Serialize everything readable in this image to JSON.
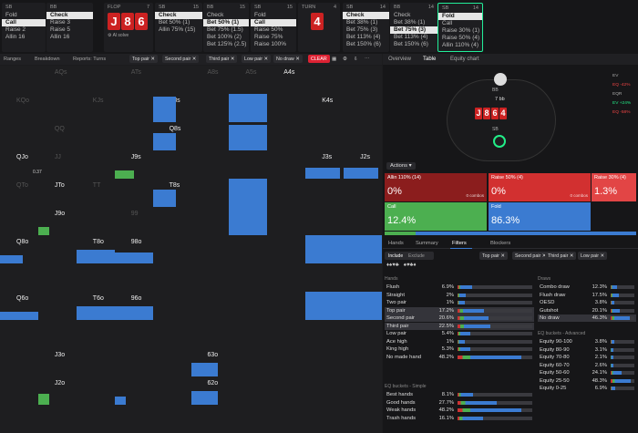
{
  "top_cols": [
    {
      "pos": "SB",
      "stack": "",
      "options": [
        {
          "l": "Fold",
          "v": "",
          "sel": false
        },
        {
          "l": "Call",
          "v": "",
          "sel": true
        },
        {
          "l": "Raise 2",
          "v": "",
          "sel": false
        },
        {
          "l": "Allin 16",
          "v": "",
          "sel": false
        }
      ]
    },
    {
      "pos": "BB",
      "stack": "",
      "options": [
        {
          "l": "Check",
          "v": "",
          "sel": true
        },
        {
          "l": "Raise 3",
          "v": "",
          "sel": false
        },
        {
          "l": "Raise 5",
          "v": "",
          "sel": false
        },
        {
          "l": "Allin 16",
          "v": "",
          "sel": false
        }
      ]
    },
    {
      "pos": "SB",
      "stack": "15",
      "options": [
        {
          "l": "Check",
          "v": "",
          "sel": true
        },
        {
          "l": "Bet 50%",
          "v": "(1)",
          "sel": false
        },
        {
          "l": "Allin 75%",
          "v": "(15)",
          "sel": false
        }
      ]
    },
    {
      "pos": "BB",
      "stack": "15",
      "options": [
        {
          "l": "Check",
          "v": "",
          "sel": false
        },
        {
          "l": "Bet 50%",
          "v": "(1)",
          "sel": true
        },
        {
          "l": "Bet 75%",
          "v": "(1.5)",
          "sel": false
        },
        {
          "l": "Bet 100%",
          "v": "(2)",
          "sel": false
        },
        {
          "l": "Bet 125%",
          "v": "(2.5)",
          "sel": false
        }
      ]
    },
    {
      "pos": "SB",
      "stack": "15",
      "options": [
        {
          "l": "Fold",
          "v": "",
          "sel": false
        },
        {
          "l": "Call",
          "v": "",
          "sel": true
        },
        {
          "l": "Raise 50%",
          "v": "",
          "sel": false
        },
        {
          "l": "Raise 75%",
          "v": "",
          "sel": false
        },
        {
          "l": "Raise 100%",
          "v": "",
          "sel": false
        }
      ]
    },
    {
      "pos": "SB",
      "stack": "14",
      "options": [
        {
          "l": "Check",
          "v": "",
          "sel": true
        },
        {
          "l": "Bet 38%",
          "v": "(1)",
          "sel": false
        },
        {
          "l": "Bet 75%",
          "v": "(3)",
          "sel": false
        },
        {
          "l": "Bet 113%",
          "v": "(4)",
          "sel": false
        },
        {
          "l": "Bet 150%",
          "v": "(6)",
          "sel": false
        }
      ]
    },
    {
      "pos": "BB",
      "stack": "14",
      "options": [
        {
          "l": "Check",
          "v": "",
          "sel": false
        },
        {
          "l": "Bet 38%",
          "v": "(1)",
          "sel": false
        },
        {
          "l": "Bet 75%",
          "v": "(3)",
          "sel": true
        },
        {
          "l": "Bet 113%",
          "v": "(4)",
          "sel": false
        },
        {
          "l": "Bet 150%",
          "v": "(6)",
          "sel": false
        }
      ]
    },
    {
      "pos": "SB",
      "stack": "14",
      "options": [
        {
          "l": "Fold",
          "v": "",
          "sel": true
        },
        {
          "l": "Call",
          "v": "",
          "sel": false
        },
        {
          "l": "Raise 30%",
          "v": "(1)",
          "sel": false
        },
        {
          "l": "Raise 50%",
          "v": "(4)",
          "sel": false
        },
        {
          "l": "Allin 110%",
          "v": "(4)",
          "sel": false
        }
      ]
    }
  ],
  "flop": {
    "label": "FLOP",
    "num": "7",
    "cards": [
      "J",
      "8",
      "6"
    ],
    "note": "Al solve"
  },
  "turn": {
    "label": "TURN",
    "num": "4",
    "card": "4"
  },
  "toolbar": {
    "ranges": "Ranges",
    "breakdown": "Breakdown",
    "reports": "Reports: Turns",
    "chips": [
      "Top pair",
      "Second pair",
      "Third pair",
      "Low pair",
      "No draw"
    ],
    "clear": "CLEAR"
  },
  "grid_cells": [
    {
      "t": "A4s",
      "r": 0,
      "c": 7,
      "on": true
    },
    {
      "t": "AQs",
      "r": 0,
      "c": 1,
      "on": false
    },
    {
      "t": "ATs",
      "r": 0,
      "c": 3,
      "on": false
    },
    {
      "t": "A8s",
      "r": 0,
      "c": 5,
      "on": false
    },
    {
      "t": "A5s",
      "r": 0,
      "c": 6,
      "on": false
    },
    {
      "t": "K8s",
      "r": 1,
      "c": 4,
      "on": true
    },
    {
      "t": "K6s",
      "r": 1,
      "c": 6,
      "on": true
    },
    {
      "t": "K4s",
      "r": 1,
      "c": 8,
      "on": true
    },
    {
      "t": "KQo",
      "r": 1,
      "c": 0,
      "on": false
    },
    {
      "t": "KJs",
      "r": 1,
      "c": 2,
      "on": false
    },
    {
      "t": "Q8s",
      "r": 2,
      "c": 4,
      "on": true
    },
    {
      "t": "Q6s",
      "r": 2,
      "c": 6,
      "on": true
    },
    {
      "t": "QQ",
      "r": 2,
      "c": 1,
      "on": false
    },
    {
      "t": "QJo",
      "r": 3,
      "c": 0,
      "on": true
    },
    {
      "t": "J9s",
      "r": 3,
      "c": 3,
      "on": true
    },
    {
      "t": "J3s",
      "r": 3,
      "c": 8,
      "on": true
    },
    {
      "t": "J2s",
      "r": 3,
      "c": 9,
      "on": true
    },
    {
      "t": "JJ",
      "r": 3,
      "c": 1,
      "on": false
    },
    {
      "t": "JTo",
      "r": 4,
      "c": 1,
      "on": true
    },
    {
      "t": "T8s",
      "r": 4,
      "c": 4,
      "on": true
    },
    {
      "t": "T6s",
      "r": 4,
      "c": 6,
      "on": true
    },
    {
      "t": "QTo",
      "r": 4,
      "c": 0,
      "on": false
    },
    {
      "t": "TT",
      "r": 4,
      "c": 2,
      "on": false
    },
    {
      "t": "J9o",
      "r": 5,
      "c": 1,
      "on": true
    },
    {
      "t": "96s",
      "r": 5,
      "c": 6,
      "on": true
    },
    {
      "t": "99",
      "r": 5,
      "c": 3,
      "on": false
    },
    {
      "t": "Q8o",
      "r": 6,
      "c": 0,
      "on": true
    },
    {
      "t": "T8o",
      "r": 6,
      "c": 2,
      "on": true
    },
    {
      "t": "98o",
      "r": 6,
      "c": 3,
      "on": true
    },
    {
      "t": "83s",
      "r": 6,
      "c": 8,
      "on": true
    },
    {
      "t": "82s",
      "r": 6,
      "c": 9,
      "on": true
    },
    {
      "t": "Q6o",
      "r": 8,
      "c": 0,
      "on": true
    },
    {
      "t": "T6o",
      "r": 8,
      "c": 2,
      "on": true
    },
    {
      "t": "96o",
      "r": 8,
      "c": 3,
      "on": true
    },
    {
      "t": "63s",
      "r": 8,
      "c": 8,
      "on": true
    },
    {
      "t": "62s",
      "r": 8,
      "c": 9,
      "on": true
    },
    {
      "t": "J3o",
      "r": 10,
      "c": 1,
      "on": true
    },
    {
      "t": "63o",
      "r": 10,
      "c": 5,
      "on": true
    },
    {
      "t": "J2o",
      "r": 11,
      "c": 1,
      "on": true
    },
    {
      "t": "62o",
      "r": 11,
      "c": 5,
      "on": true
    }
  ],
  "grid_labels": {
    "a": "0.37"
  },
  "rp": {
    "tabs": [
      "Overview",
      "Table",
      "Equity chart"
    ],
    "pot": "7 bb",
    "board": [
      "J",
      "8",
      "6",
      "4"
    ],
    "sb": "SB",
    "bb": "BB",
    "side": [
      {
        "k": "EV",
        "v": ""
      },
      {
        "k": "EQ",
        "v": "-42%"
      },
      {
        "k": "EQR",
        "v": ""
      },
      {
        "k": "EV",
        "v": "+24%"
      },
      {
        "k": "EQ",
        "v": "-58%"
      }
    ],
    "actions_label": "Actions"
  },
  "actions": [
    {
      "name": "Allin 110%",
      "sub": "(14)",
      "pct": "0%",
      "combos": "0 combos",
      "color": "#8b1d1d"
    },
    {
      "name": "Raise 50%",
      "sub": "(4)",
      "pct": "0%",
      "combos": "0 combos",
      "color": "#d23030"
    },
    {
      "name": "Raise 30%",
      "sub": "(4)",
      "pct": "1.3%",
      "combos": "",
      "color": "#e24545"
    },
    {
      "name": "Call",
      "sub": "",
      "pct": "12.4%",
      "combos": "",
      "color": "#4caf50"
    },
    {
      "name": "Fold",
      "sub": "",
      "pct": "86.3%",
      "combos": "",
      "color": "#3b7bd1"
    }
  ],
  "subtabs": [
    "Hands",
    "Summary",
    "Filters",
    "Blockers"
  ],
  "filter_toggle": [
    "Include",
    "Exclude"
  ],
  "hands_title": "Hands",
  "hands": [
    {
      "l": "Flush",
      "v": "6.9%"
    },
    {
      "l": "Straight",
      "v": "2%"
    },
    {
      "l": "Two pair",
      "v": "1%"
    },
    {
      "l": "Top pair",
      "v": "17.2%"
    },
    {
      "l": "Second pair",
      "v": "20.6%"
    },
    {
      "l": "Third pair",
      "v": "22.5%"
    },
    {
      "l": "Low pair",
      "v": "5.4%"
    },
    {
      "l": "Ace high",
      "v": "1%"
    },
    {
      "l": "King high",
      "v": "5.3%"
    },
    {
      "l": "No made hand",
      "v": "48.2%"
    }
  ],
  "draws_title": "Draws",
  "draws": [
    {
      "l": "Combo draw",
      "v": "12.3%"
    },
    {
      "l": "Flush draw",
      "v": "17.5%"
    },
    {
      "l": "OESD",
      "v": "3.8%"
    },
    {
      "l": "Gutshot",
      "v": "20.1%"
    },
    {
      "l": "No draw",
      "v": "46.3%"
    }
  ],
  "eqa_title": "EQ buckets - Advanced",
  "eqa": [
    {
      "l": "Equity 90-100",
      "v": "3.8%"
    },
    {
      "l": "Equity 80-90",
      "v": "3.1%"
    },
    {
      "l": "Equity 70-80",
      "v": "2.1%"
    },
    {
      "l": "Equity 60-70",
      "v": "2.6%"
    },
    {
      "l": "Equity 50-60",
      "v": "24.1%"
    },
    {
      "l": "Equity 25-50",
      "v": "48.3%"
    },
    {
      "l": "Equity 0-25",
      "v": "6.9%"
    }
  ],
  "eqs_title": "EQ buckets - Simple",
  "eqs": [
    {
      "l": "Best hands",
      "v": "8.1%"
    },
    {
      "l": "Good hands",
      "v": "27.7%"
    },
    {
      "l": "Weak hands",
      "v": "48.2%"
    },
    {
      "l": "Trash hands",
      "v": "16.1%"
    }
  ],
  "filters_chips": [
    "Top pair",
    "Second pair",
    "Third pair",
    "Low pair"
  ]
}
